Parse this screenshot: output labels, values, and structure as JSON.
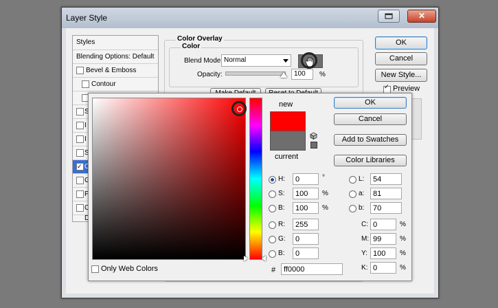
{
  "window": {
    "title": "Layer Style",
    "close_glyph": "✕"
  },
  "styles_list": {
    "header": "Styles",
    "blending": "Blending Options: Default",
    "items": [
      {
        "label": "Bevel & Emboss"
      },
      {
        "label": "Contour"
      }
    ],
    "visible_prefixes": [
      "S",
      "I",
      "I",
      "S",
      "C",
      "G",
      "P",
      "C",
      "D"
    ]
  },
  "overlay": {
    "section": "Color Overlay",
    "subsection": "Color",
    "blend_mode_label": "Blend Mode:",
    "blend_mode_value": "Normal",
    "opacity_label": "Opacity:",
    "opacity_value": "100",
    "opacity_unit": "%",
    "opacity_fraction": 1.0,
    "make_default": "Make Default",
    "reset_default": "Reset to Default"
  },
  "main_buttons": {
    "ok": "OK",
    "cancel": "Cancel",
    "new_style": "New Style...",
    "preview": "Preview",
    "preview_checked": true
  },
  "picker": {
    "new_label": "new",
    "current_label": "current",
    "new_color": "#ff0000",
    "current_color": "#6e6e6e",
    "ok": "OK",
    "cancel": "Cancel",
    "add_swatches": "Add to Swatches",
    "color_libraries": "Color Libraries",
    "only_web": "Only Web Colors",
    "hsb": [
      {
        "label": "H:",
        "value": "0",
        "unit": "°",
        "selected": true
      },
      {
        "label": "S:",
        "value": "100",
        "unit": "%",
        "selected": false
      },
      {
        "label": "B:",
        "value": "100",
        "unit": "%",
        "selected": false
      }
    ],
    "rgb": [
      {
        "label": "R:",
        "value": "255"
      },
      {
        "label": "G:",
        "value": "0"
      },
      {
        "label": "B:",
        "value": "0"
      }
    ],
    "lab": [
      {
        "label": "L:",
        "value": "54"
      },
      {
        "label": "a:",
        "value": "81"
      },
      {
        "label": "b:",
        "value": "70"
      }
    ],
    "cmyk": [
      {
        "label": "C:",
        "value": "0",
        "unit": "%"
      },
      {
        "label": "M:",
        "value": "99",
        "unit": "%"
      },
      {
        "label": "Y:",
        "value": "100",
        "unit": "%"
      },
      {
        "label": "K:",
        "value": "0",
        "unit": "%"
      }
    ],
    "hex_label": "#",
    "hex_value": "ff0000"
  },
  "icons": [
    "restore-icon",
    "close-icon",
    "hand-cursor-icon",
    "cube-icon",
    "web-swatch-icon",
    "dropdown-arrow-icon"
  ]
}
